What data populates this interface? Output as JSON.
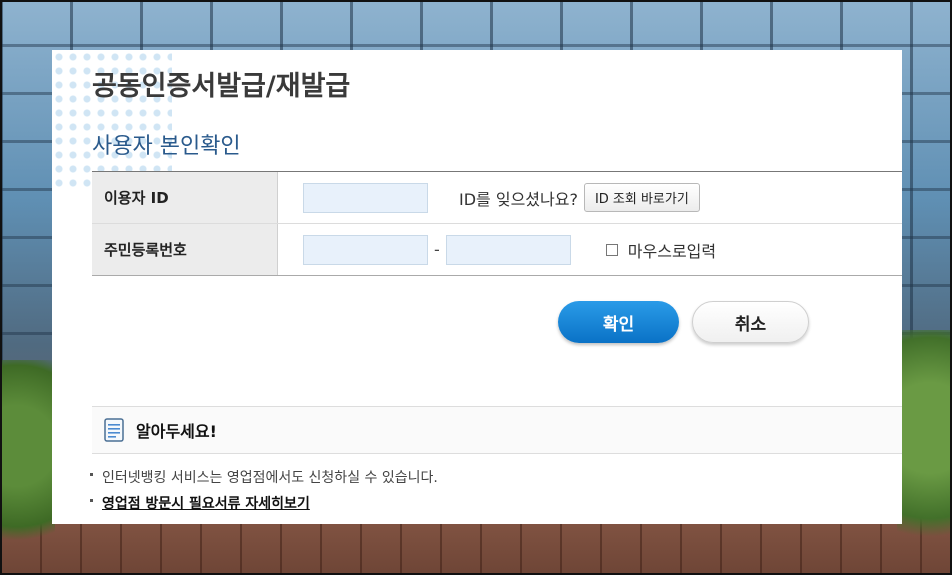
{
  "page": {
    "title": "공동인증서발급/재발급",
    "subtitle": "사용자 본인확인"
  },
  "form": {
    "user_id_label": "이용자 ID",
    "user_id_value": "",
    "forgot_id_text": "ID를 잊으셨나요?",
    "id_lookup_button": "ID 조회 바로가기",
    "rrn_label": "주민등록번호",
    "rrn_front_value": "",
    "rrn_separator": "-",
    "rrn_back_value": "",
    "mouse_input_label": "마우스로입력",
    "mouse_input_checked": false
  },
  "actions": {
    "confirm_label": "확인",
    "cancel_label": "취소",
    "confirm_color": "#0a72c6"
  },
  "notice": {
    "title": "알아두세요!",
    "icon": "document-icon",
    "items": [
      "인터넷뱅킹 서비스는 영업점에서도 신청하실 수 있습니다.",
      "영업점 방문시 필요서류 자세히보기"
    ]
  }
}
